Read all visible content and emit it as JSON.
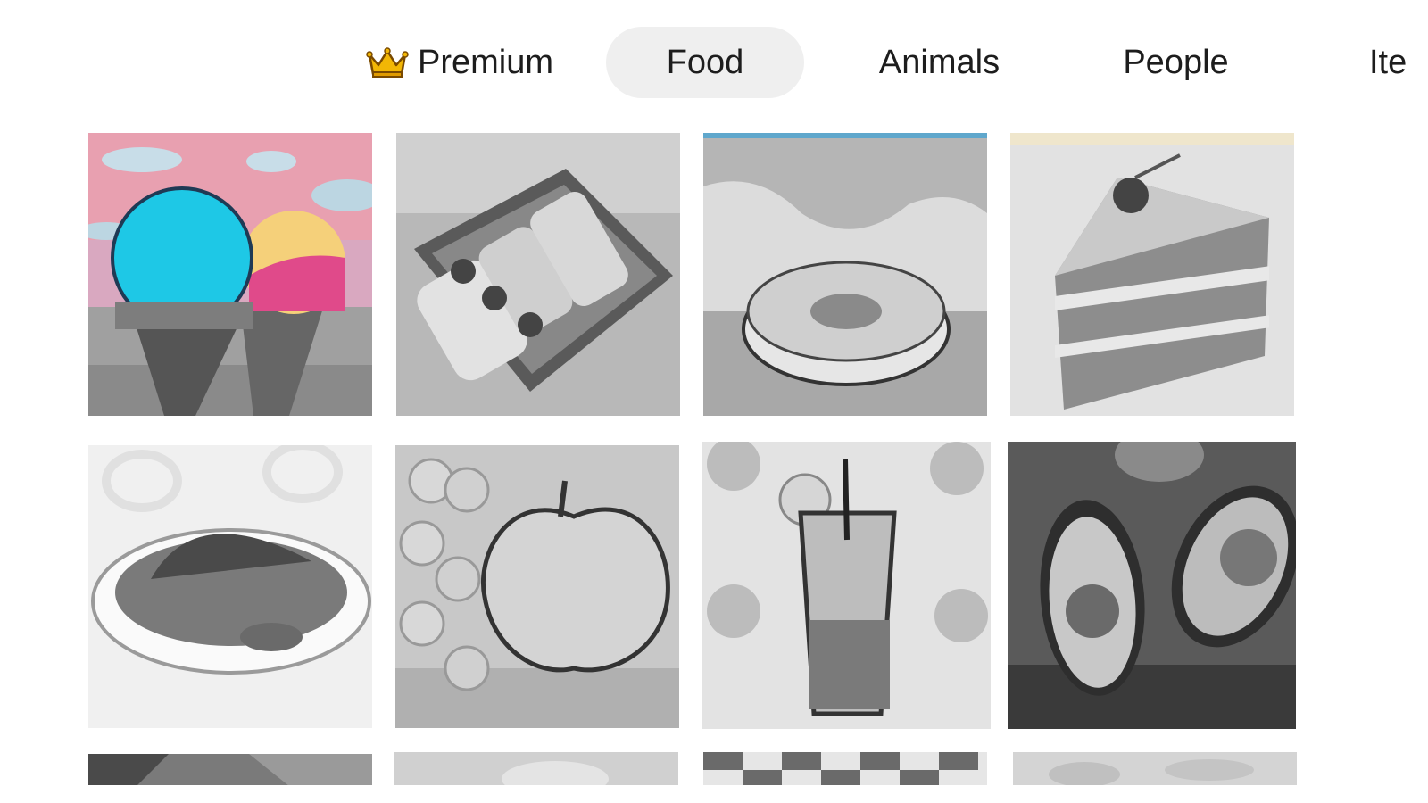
{
  "category_tabs": [
    {
      "label": "Premium",
      "icon": "crown-icon",
      "selected": false
    },
    {
      "label": "Food",
      "selected": true
    },
    {
      "label": "Animals",
      "selected": false
    },
    {
      "label": "People",
      "selected": false
    },
    {
      "label": "Ite",
      "selected": false
    }
  ],
  "colors": {
    "selected_tab_bg": "#efefef",
    "crown": "#f0b400",
    "ice_cream_sky": "#e8a0b0",
    "ice_cream_blue": "#1ec8e6",
    "ice_cream_pink": "#e04a8a",
    "ice_cream_yellow": "#f5d07a"
  },
  "gallery": {
    "artworks": [
      {
        "subject": "ice-cream-cones",
        "colored": true
      },
      {
        "subject": "sushi-box",
        "colored": false
      },
      {
        "subject": "donut",
        "colored": false
      },
      {
        "subject": "cake-slice",
        "colored": false
      },
      {
        "subject": "spaghetti-plate",
        "colored": false
      },
      {
        "subject": "apple-and-grapes",
        "colored": false
      },
      {
        "subject": "iced-drink",
        "colored": false
      },
      {
        "subject": "avocados",
        "colored": false
      }
    ]
  }
}
